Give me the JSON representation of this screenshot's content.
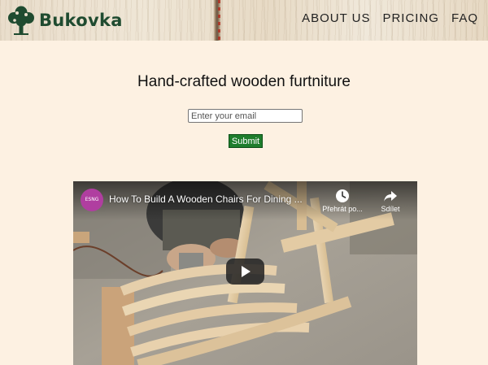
{
  "brand": {
    "name": "Bukovka",
    "logo_icon": "tree-icon",
    "color": "#1f4b30"
  },
  "nav": {
    "items": [
      {
        "label": "ABOUT US"
      },
      {
        "label": "PRICING"
      },
      {
        "label": "FAQ"
      }
    ]
  },
  "main": {
    "title": "Hand-crafted wooden furtniture",
    "email_placeholder": "Enter your email",
    "submit_label": "Submit",
    "submit_color": "#1e7d2c"
  },
  "video": {
    "title": "How To Build A Wooden Chairs For Dining ...",
    "channel_avatar_text": "ESNG",
    "watch_later_label": "Přehrát po...",
    "share_label": "Sdílet",
    "icons": [
      "clock-icon",
      "share-icon",
      "play-icon"
    ]
  },
  "colors": {
    "page_background": "#fdf1e2",
    "nav_text": "#222222"
  }
}
